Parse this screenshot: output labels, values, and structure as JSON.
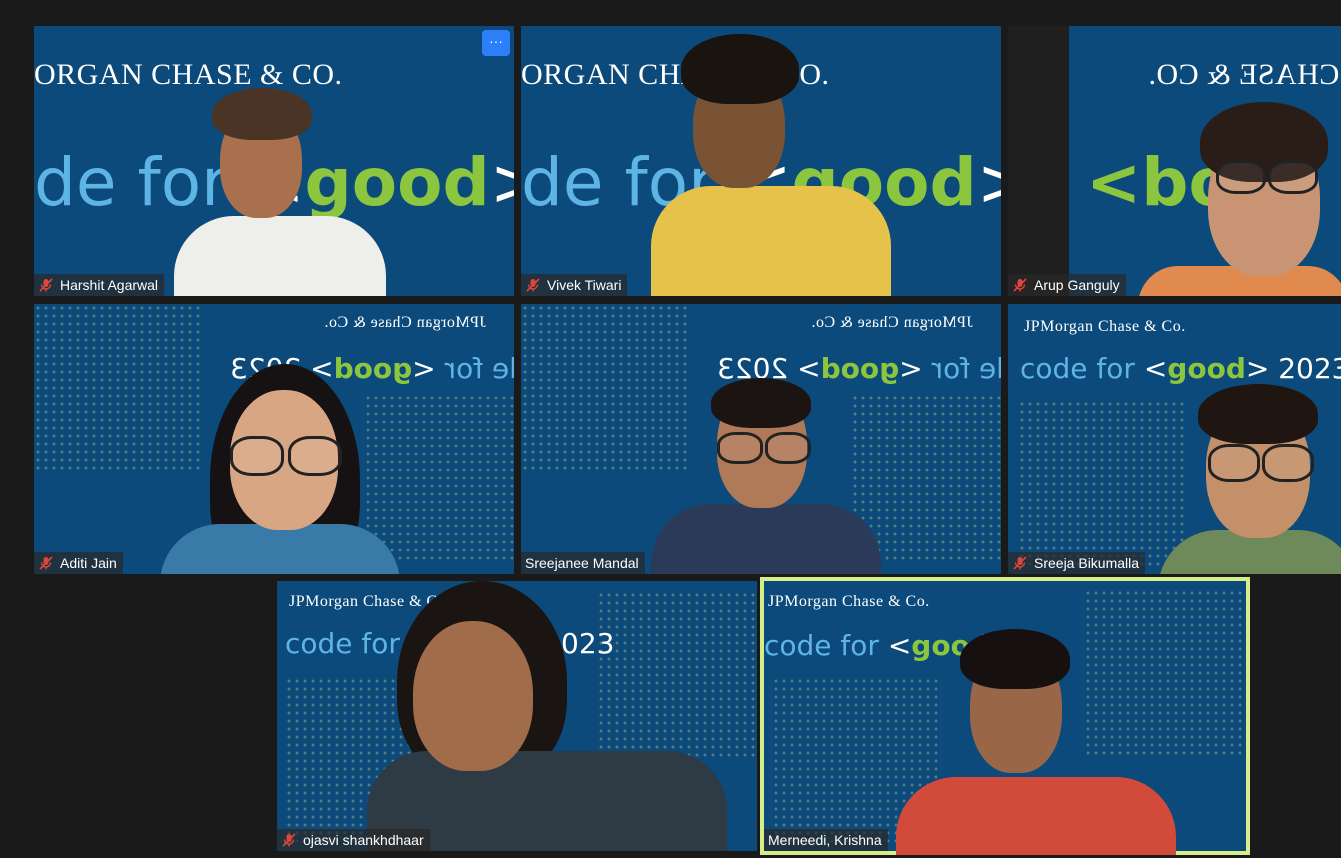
{
  "meeting": {
    "participants": [
      {
        "name": "Harshit Agarwal",
        "muted": true
      },
      {
        "name": "Vivek Tiwari",
        "muted": true
      },
      {
        "name": "Arup Ganguly",
        "muted": true
      },
      {
        "name": "Aditi Jain",
        "muted": true
      },
      {
        "name": "Sreejanee Mandal",
        "muted": false
      },
      {
        "name": "Sreeja Bikumalla",
        "muted": true
      },
      {
        "name": "ojasvi shankhdhaar",
        "muted": true
      },
      {
        "name": "Merneedi, Krishna",
        "muted": false,
        "active_speaker": true
      }
    ],
    "more_button_label": "···"
  },
  "backgrounds": {
    "logo_full": "JPMorgan Chase & Co.",
    "logo_cropped": "ORGAN CHASE & CO.",
    "logo_mirrored": "CHASE & CO.",
    "tag_prefix": "code for ",
    "tag_open": "<",
    "tag_word": "good",
    "tag_close": ">",
    "tag_year": "2023",
    "tag_cropped_prefix": "de for ",
    "tag_cropped_year": "20",
    "tag_mirrored_word": "<boo"
  },
  "colors": {
    "background": "#1a1a1a",
    "tile_blue": "#0b4a7a",
    "active_border": "#d4ef8a",
    "more_button": "#2d7ff9",
    "muted_icon": "#e0453a"
  },
  "icons": {
    "mic_muted": "mic-off-icon",
    "more": "more-options-icon"
  }
}
